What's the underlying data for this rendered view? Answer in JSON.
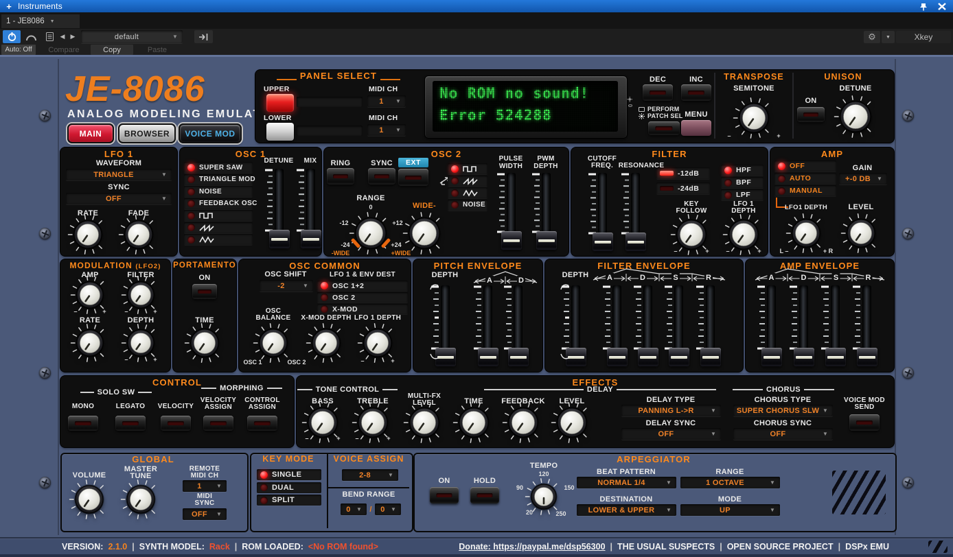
{
  "chrome": {
    "plus": "+",
    "window_title": "Instruments",
    "tab": "1 - JE8086",
    "preset": "default",
    "auto": "Auto: Off",
    "compare": "Compare",
    "copy": "Copy",
    "paste": "Paste",
    "xkey": "Xkey"
  },
  "header": {
    "logo": "JE-8086",
    "subtitle": "ANALOG MODELING EMULATOR",
    "main": "MAIN",
    "browser": "BROWSER",
    "voice_mod": "VOICE MOD"
  },
  "panel_select": {
    "title": "PANEL SELECT",
    "upper": "UPPER",
    "lower": "LOWER",
    "midi_ch_upper": "MIDI CH",
    "midi_ch_lower": "MIDI CH",
    "upper_ch": "1",
    "lower_ch": "1"
  },
  "lcd": {
    "line1": "No ROM no sound!",
    "line2": "Error 524288",
    "brightness": "0"
  },
  "prog": {
    "dec": "DEC",
    "inc": "INC",
    "perform": "PERFORM",
    "patch_sel": "PATCH SEL",
    "menu": "MENU"
  },
  "transpose": {
    "title": "TRANSPOSE",
    "semitone": "SEMITONE",
    "min": "–",
    "max": "+"
  },
  "unison": {
    "title": "UNISON",
    "on": "ON",
    "detune": "DETUNE"
  },
  "lfo1": {
    "title": "LFO 1",
    "waveform_label": "WAVEFORM",
    "waveform": "TRIANGLE",
    "sync_label": "SYNC",
    "sync": "OFF",
    "rate": "RATE",
    "fade": "FADE"
  },
  "osc1": {
    "title": "OSC 1",
    "modes": [
      "SUPER SAW",
      "TRIANGLE MOD",
      "NOISE",
      "FEEDBACK OSC",
      {
        "icon": "square-wave"
      },
      {
        "icon": "saw-wave"
      },
      {
        "icon": "triangle-wave"
      }
    ],
    "detune": "DETUNE",
    "mix": "MIX"
  },
  "osc2": {
    "title": "OSC 2",
    "ring": "RING",
    "sync": "SYNC",
    "ext": "EXT",
    "waves": [
      {
        "icon": "square-wave"
      },
      {
        "icon": "saw-wave"
      },
      {
        "icon": "triangle-wave"
      },
      "NOISE"
    ],
    "range": "RANGE",
    "marks": {
      "zero": "0",
      "m12": "-12",
      "p12": "+12",
      "m24": "-24",
      "p24": "+24",
      "mwide": "-WIDE",
      "pwide": "+WIDE"
    },
    "wide": "WIDE-",
    "pw1": "PULSE",
    "pw2": "WIDTH",
    "pwm1": "PWM",
    "pwm2": "DEPTH"
  },
  "filter": {
    "title": "FILTER",
    "cutoff1": "CUTOFF",
    "cutoff2": "FREQ.",
    "resonance": "RESONANCE",
    "slopes": [
      "-12dB",
      "-24dB"
    ],
    "types": [
      "HPF",
      "BPF",
      "LPF"
    ],
    "kf1": "KEY",
    "kf2": "FOLLOW",
    "ld1": "LFO 1",
    "ld2": "DEPTH",
    "min": "–",
    "max": "+"
  },
  "amp": {
    "title": "AMP",
    "modes": [
      "OFF",
      "AUTO",
      "MANUAL"
    ],
    "gain_label": "GAIN",
    "gain": "+-0 DB",
    "lfo1_depth": "LFO1 DEPTH",
    "level": "LEVEL",
    "l": "L –",
    "r": "+ R"
  },
  "modulation": {
    "title": "MODULATION",
    "sub": "(LFO2)",
    "amp": "AMP",
    "filter": "FILTER",
    "rate": "RATE",
    "depth": "DEPTH",
    "min": "–",
    "max": "+"
  },
  "portamento": {
    "title": "PORTAMENTO",
    "on": "ON",
    "time": "TIME"
  },
  "osc_common": {
    "title": "OSC COMMON",
    "shift_label": "OSC SHIFT",
    "shift": "-2",
    "dest_label": "LFO 1 & ENV DEST",
    "dest": [
      "OSC 1+2",
      "OSC 2",
      "X-MOD"
    ],
    "bal1": "OSC",
    "bal2": "BALANCE",
    "osc1": "OSC 1",
    "osc2": "OSC 2",
    "xmod": "X-MOD DEPTH",
    "lfo1_depth": "LFO 1 DEPTH",
    "min": "–",
    "max": "+"
  },
  "pitch_env": {
    "title": "PITCH ENVELOPE",
    "depth": "DEPTH",
    "stages": [
      "A",
      "D"
    ]
  },
  "filter_env": {
    "title": "FILTER ENVELOPE",
    "depth": "DEPTH",
    "stages": [
      "A",
      "D",
      "S",
      "R"
    ]
  },
  "amp_env": {
    "title": "AMP ENVELOPE",
    "stages": [
      "A",
      "D",
      "S",
      "R"
    ]
  },
  "control": {
    "title": "CONTROL",
    "solo": "SOLO SW",
    "morphing": "MORPHING",
    "mono": "MONO",
    "legato": "LEGATO",
    "velocity": "VELOCITY",
    "va1": "VELOCITY",
    "va2": "ASSIGN",
    "ca1": "CONTROL",
    "ca2": "ASSIGN"
  },
  "effects": {
    "title": "EFFECTS",
    "tone": "TONE CONTROL",
    "bass": "BASS",
    "treble": "TREBLE",
    "mfx1": "MULTI-FX",
    "mfx2": "LEVEL",
    "delay": "DELAY",
    "time": "TIME",
    "feedback": "FEEDBACK",
    "level": "LEVEL",
    "delay_type_label": "DELAY TYPE",
    "delay_type": "PANNING L->R",
    "delay_sync_label": "DELAY SYNC",
    "delay_sync": "OFF",
    "chorus": "CHORUS",
    "chorus_type_label": "CHORUS TYPE",
    "chorus_type": "SUPER CHORUS SLW",
    "chorus_sync_label": "CHORUS SYNC",
    "chorus_sync": "OFF",
    "vms1": "VOICE MOD",
    "vms2": "SEND",
    "min": "–",
    "max": "+"
  },
  "global": {
    "title": "GLOBAL",
    "volume": "VOLUME",
    "mt1": "MASTER",
    "mt2": "TUNE",
    "r1": "REMOTE",
    "r2": "MIDI CH",
    "remote": "1",
    "s1": "MIDI",
    "s2": "SYNC",
    "midi_sync": "OFF"
  },
  "key_mode": {
    "title": "KEY MODE",
    "modes": [
      "SINGLE",
      "DUAL",
      "SPLIT"
    ]
  },
  "voice_assign": {
    "title": "VOICE ASSIGN",
    "value": "2-8",
    "bend_label": "BEND RANGE",
    "bend1": "0",
    "slash": "/",
    "bend2": "0"
  },
  "arp": {
    "title": "ARPEGGIATOR",
    "on": "ON",
    "hold": "HOLD",
    "tempo": "TEMPO",
    "marks": {
      "t120": "120",
      "t90": "90",
      "t150": "150",
      "t20": "20",
      "t250": "250"
    },
    "beat_label": "BEAT PATTERN",
    "beat": "NORMAL 1/4",
    "range_label": "RANGE",
    "range": "1 OCTAVE",
    "dest_label": "DESTINATION",
    "dest": "LOWER & UPPER",
    "mode_label": "MODE",
    "mode": "UP"
  },
  "footer": {
    "version_label": "VERSION:",
    "version": "2.1.0",
    "sep": "|",
    "model_label": "SYNTH MODEL:",
    "model": "Rack",
    "rom_label": "ROM LOADED:",
    "rom": "<No ROM found>",
    "donate": "Donate: https://paypal.me/dsp56300",
    "c1": "THE USUAL SUSPECTS",
    "c2": "OPEN SOURCE PROJECT",
    "c3": "DSPx EMU"
  }
}
